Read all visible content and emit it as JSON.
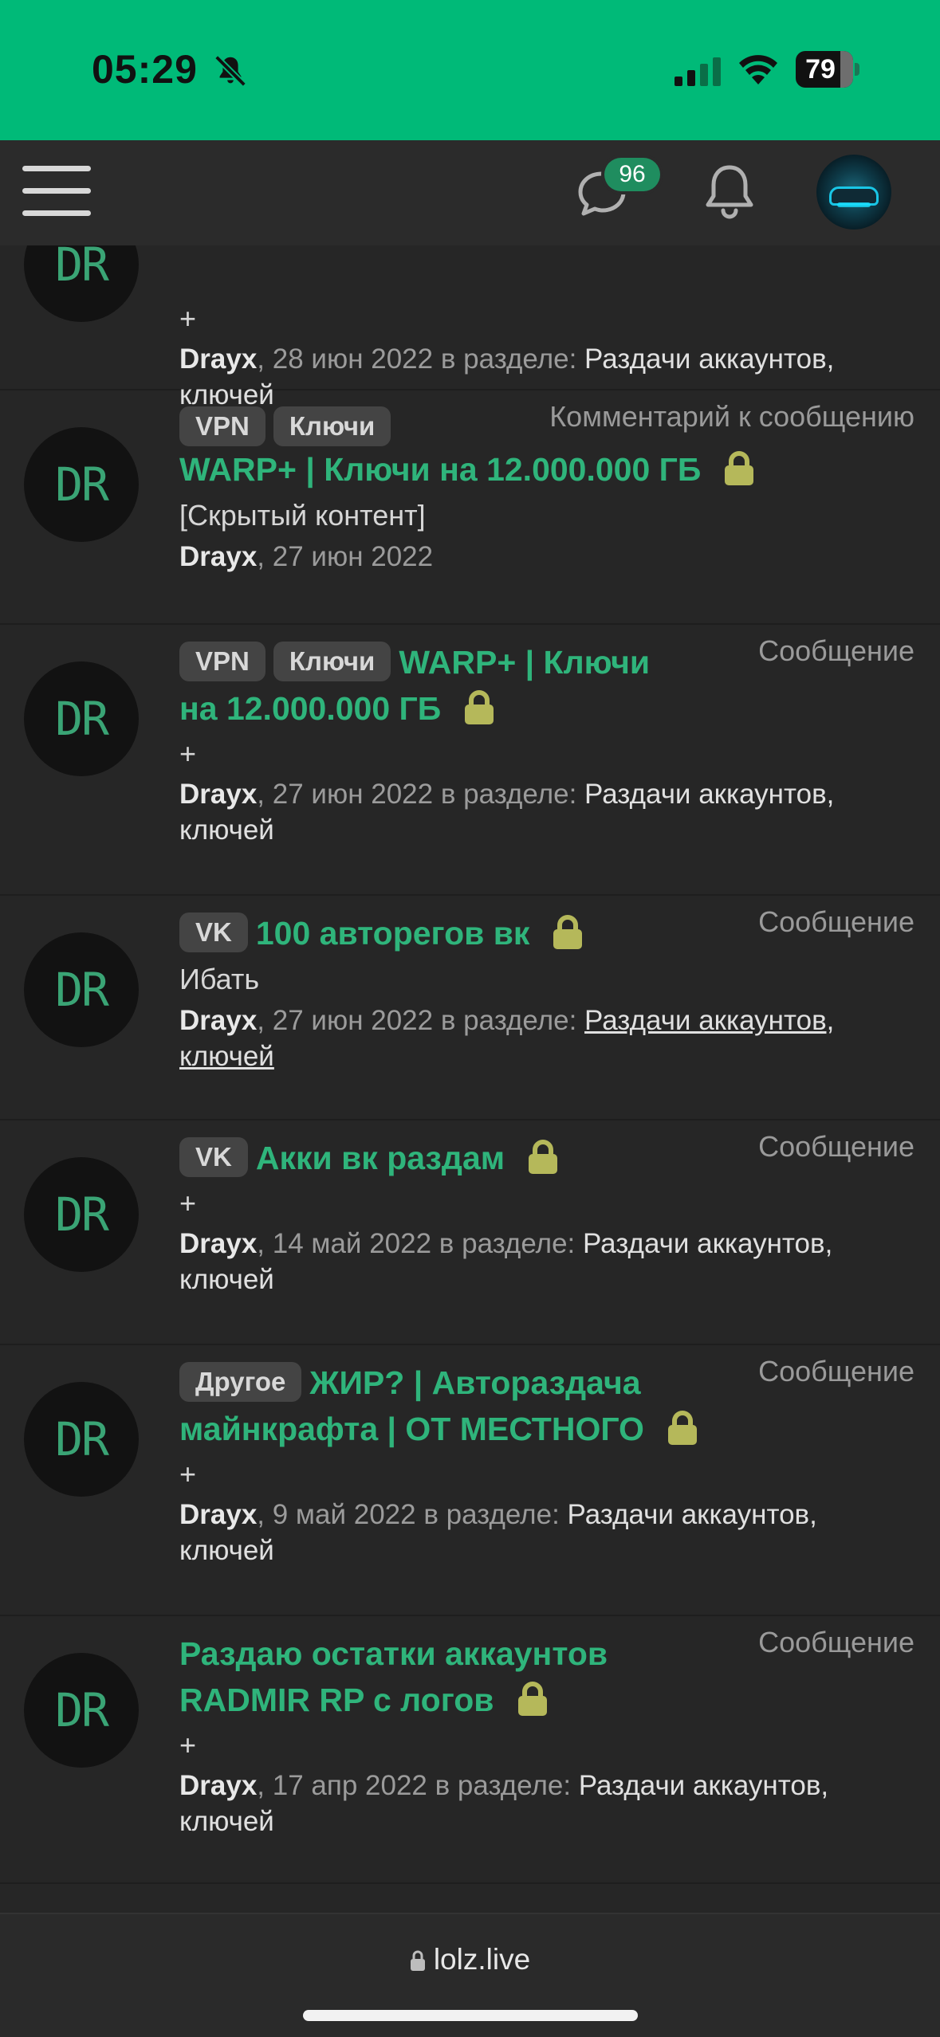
{
  "status": {
    "time": "05:29",
    "battery": "79",
    "battery_level": 0.79
  },
  "nav": {
    "messages_badge": "96"
  },
  "items": [
    {
      "kind": "",
      "tags": [],
      "title": "",
      "excerpt": "+",
      "author": "Drayx",
      "date": ", 28 июн 2022 в разделе: ",
      "section": "Раздачи аккаунтов, ключей",
      "avatar": "DR"
    },
    {
      "kind": "Комментарий к сообщению",
      "tags": [
        "VPN",
        "Ключи"
      ],
      "title": "WARP+ | Ключи на 12.000.000 ГБ",
      "excerpt": "[Скрытый контент]",
      "author": "Drayx",
      "date": ", 27 июн 2022",
      "section": "",
      "avatar": "DR"
    },
    {
      "kind": "Сообщение",
      "tags": [
        "VPN",
        "Ключи"
      ],
      "title_part1": "WARP+ | Ключи",
      "title_part2": "на 12.000.000 ГБ",
      "excerpt": "+",
      "author": "Drayx",
      "date": ", 27 июн 2022 в разделе: ",
      "section": "Раздачи аккаунтов, ключей",
      "avatar": "DR"
    },
    {
      "kind": "Сообщение",
      "tags": [
        "VK"
      ],
      "title": "100 авторегов вк",
      "excerpt": "Ибать",
      "author": "Drayx",
      "date": ", 27 июн 2022 в разделе: ",
      "section": "Раздачи аккаунтов, ключей",
      "avatar": "DR"
    },
    {
      "kind": "Сообщение",
      "tags": [
        "VK"
      ],
      "title": "Акки вк раздам",
      "excerpt": "+",
      "author": "Drayx",
      "date": ", 14 май 2022 в разделе: ",
      "section": "Раздачи аккаунтов, ключей",
      "avatar": "DR"
    },
    {
      "kind": "Сообщение",
      "tags": [
        "Другое"
      ],
      "title_part1": "ЖИР? | Автораздача",
      "title_part2": "майнкрафта | ОТ МЕСТНОГО",
      "excerpt": "+",
      "author": "Drayx",
      "date": ", 9 май 2022 в разделе: ",
      "section": "Раздачи аккаунтов, ключей",
      "avatar": "DR"
    },
    {
      "kind": "Сообщение",
      "tags": [],
      "title_part1": "Раздаю остатки аккаунтов",
      "title_part2": "RADMIR RP с логов",
      "excerpt": "+",
      "author": "Drayx",
      "date": ", 17 апр 2022 в разделе: ",
      "section": "Раздачи аккаунтов, ключей",
      "avatar": "DR"
    }
  ],
  "browser": {
    "url": "lolz.live"
  },
  "colors": {
    "accent": "#00ba78",
    "title_green": "#2fb47b",
    "lock": "#b5b85a",
    "background": "#262626"
  }
}
